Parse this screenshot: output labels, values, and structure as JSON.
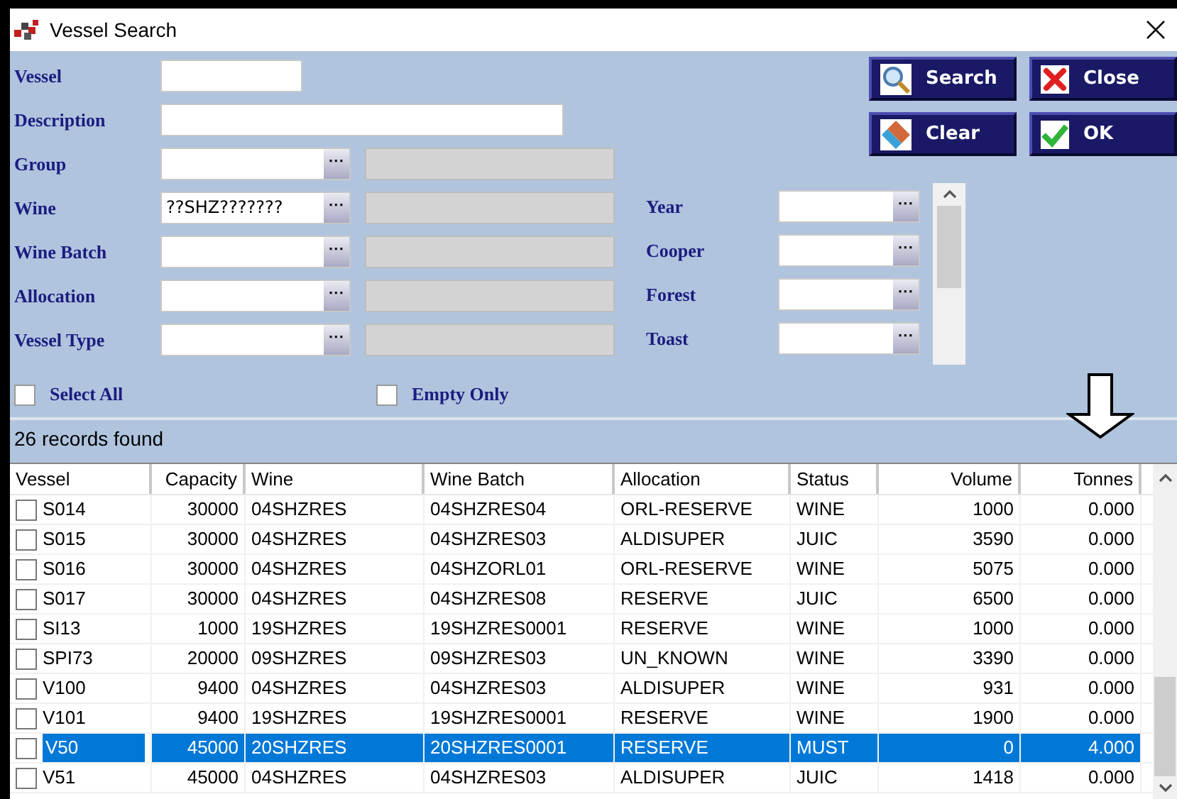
{
  "window": {
    "title": "Vessel Search"
  },
  "fields_left": [
    {
      "label": "Vessel",
      "kind": "short"
    },
    {
      "label": "Description",
      "kind": "wide"
    },
    {
      "label": "Group",
      "kind": "lookup"
    },
    {
      "label": "Wine",
      "kind": "lookup",
      "value": "??SHZ???????"
    },
    {
      "label": "Wine Batch",
      "kind": "lookup"
    },
    {
      "label": "Allocation",
      "kind": "lookup"
    },
    {
      "label": "Vessel Type",
      "kind": "lookup"
    }
  ],
  "fields_right": [
    {
      "label": "Year"
    },
    {
      "label": "Cooper"
    },
    {
      "label": "Forest"
    },
    {
      "label": "Toast"
    }
  ],
  "buttons": [
    {
      "label": "Search",
      "kind": "search"
    },
    {
      "label": "Close",
      "kind": "close"
    },
    {
      "label": "Clear",
      "kind": "clear"
    },
    {
      "label": "OK",
      "kind": "ok"
    }
  ],
  "lookup_button": "···",
  "options": [
    {
      "label": "Select All",
      "checked": false
    },
    {
      "label": "Empty Only",
      "checked": false
    }
  ],
  "status": "26 records found",
  "table": {
    "columns": [
      {
        "label": "Vessel",
        "kind": "text"
      },
      {
        "label": "Capacity",
        "kind": "number"
      },
      {
        "label": "Wine",
        "kind": "text"
      },
      {
        "label": "Wine Batch",
        "kind": "text"
      },
      {
        "label": "Allocation",
        "kind": "text"
      },
      {
        "label": "Status",
        "kind": "text"
      },
      {
        "label": "Volume",
        "kind": "number"
      },
      {
        "label": "Tonnes",
        "kind": "number"
      }
    ],
    "rows": [
      {
        "checked": false,
        "selected": false,
        "cells": [
          "S014",
          "30000",
          "04SHZRES",
          "04SHZRES04",
          "ORL-RESERVE",
          "WINE",
          "1000",
          "0.000"
        ]
      },
      {
        "checked": false,
        "selected": false,
        "cells": [
          "S015",
          "30000",
          "04SHZRES",
          "04SHZRES03",
          "ALDISUPER",
          "JUIC",
          "3590",
          "0.000"
        ]
      },
      {
        "checked": false,
        "selected": false,
        "cells": [
          "S016",
          "30000",
          "04SHZRES",
          "04SHZORL01",
          "ORL-RESERVE",
          "WINE",
          "5075",
          "0.000"
        ]
      },
      {
        "checked": false,
        "selected": false,
        "cells": [
          "S017",
          "30000",
          "04SHZRES",
          "04SHZRES08",
          "RESERVE",
          "JUIC",
          "6500",
          "0.000"
        ]
      },
      {
        "checked": false,
        "selected": false,
        "cells": [
          "SI13",
          "1000",
          "19SHZRES",
          "19SHZRES0001",
          "RESERVE",
          "WINE",
          "1000",
          "0.000"
        ]
      },
      {
        "checked": false,
        "selected": false,
        "cells": [
          "SPI73",
          "20000",
          "09SHZRES",
          "09SHZRES03",
          "UN_KNOWN",
          "WINE",
          "3390",
          "0.000"
        ]
      },
      {
        "checked": false,
        "selected": false,
        "cells": [
          "V100",
          "9400",
          "04SHZRES",
          "04SHZRES03",
          "ALDISUPER",
          "WINE",
          "931",
          "0.000"
        ]
      },
      {
        "checked": false,
        "selected": false,
        "cells": [
          "V101",
          "9400",
          "19SHZRES",
          "19SHZRES0001",
          "RESERVE",
          "WINE",
          "1900",
          "0.000"
        ]
      },
      {
        "checked": false,
        "selected": true,
        "cells": [
          "V50",
          "45000",
          "20SHZRES",
          "20SHZRES0001",
          "RESERVE",
          "MUST",
          "0",
          "4.000"
        ]
      },
      {
        "checked": false,
        "selected": false,
        "cells": [
          "V51",
          "45000",
          "04SHZRES",
          "04SHZRES03",
          "ALDISUPER",
          "JUIC",
          "1418",
          "0.000"
        ]
      }
    ]
  }
}
